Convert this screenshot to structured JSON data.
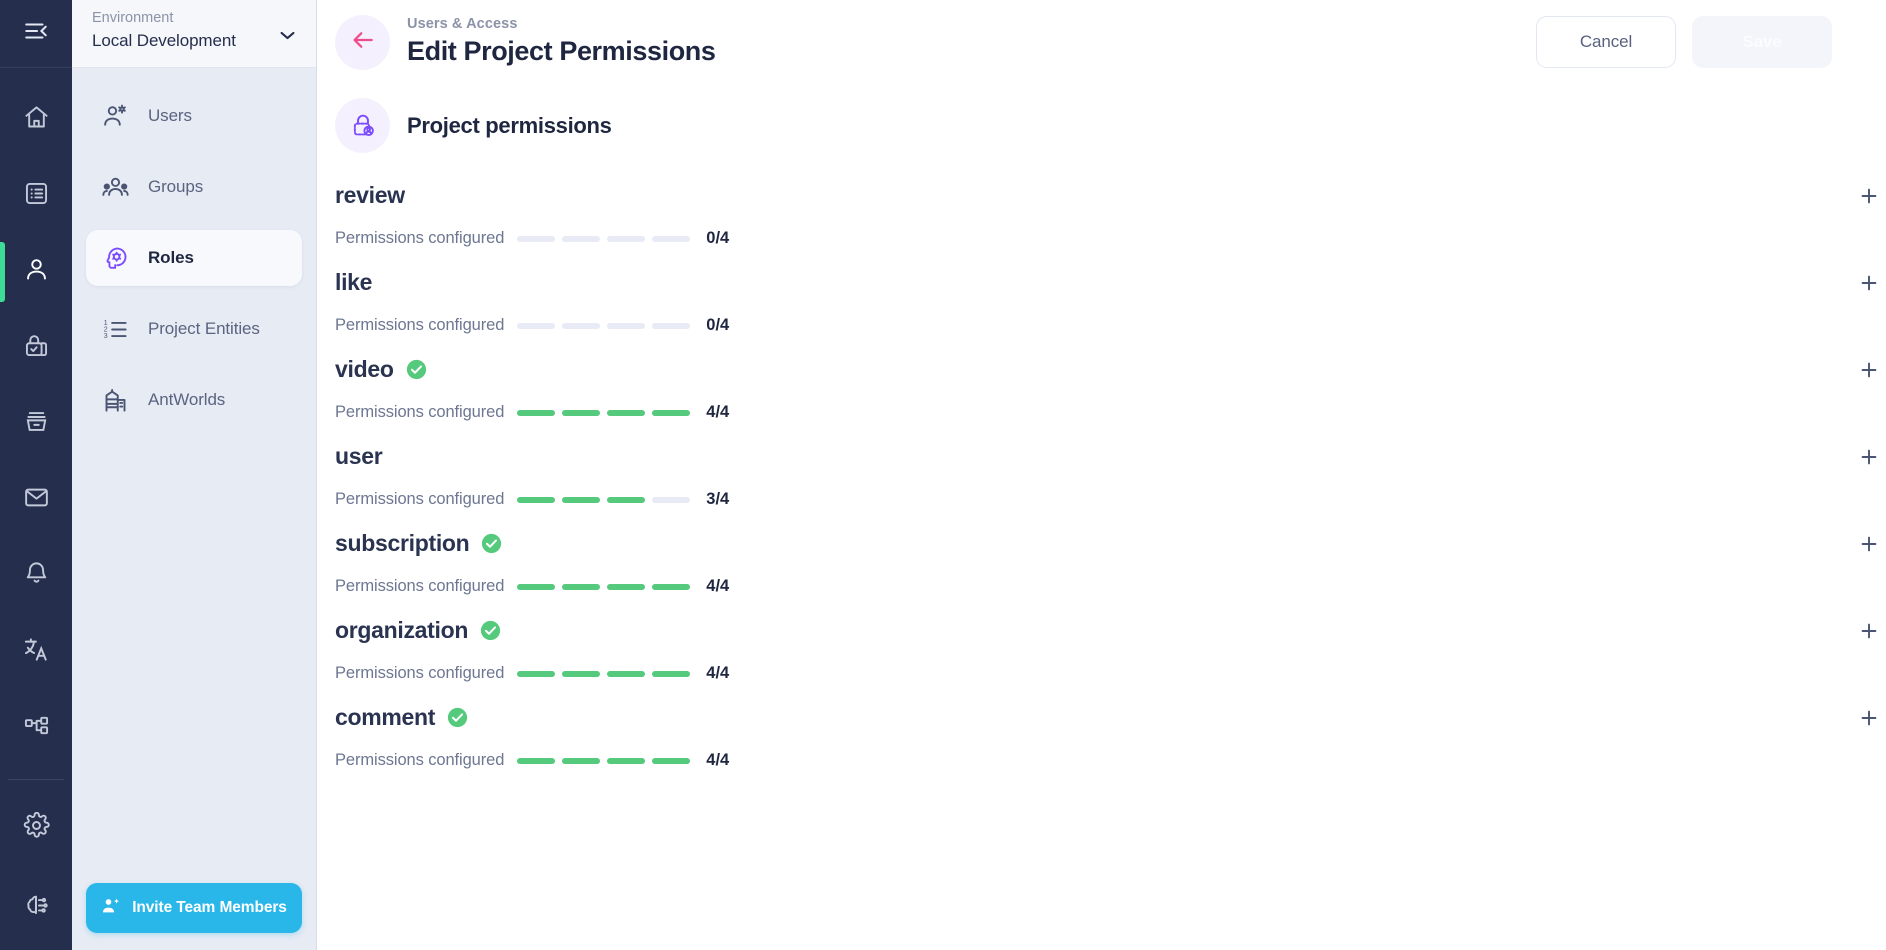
{
  "rail": {
    "collapse_icon": "collapse-sidebar-icon",
    "items": [
      {
        "name": "home",
        "icon": "home-icon",
        "active": false
      },
      {
        "name": "content",
        "icon": "list-box-icon",
        "active": false
      },
      {
        "name": "users-access",
        "icon": "person-icon",
        "active": true
      },
      {
        "name": "security",
        "icon": "lock-check-icon",
        "active": false
      },
      {
        "name": "storage",
        "icon": "archive-icon",
        "active": false
      },
      {
        "name": "mail",
        "icon": "envelope-icon",
        "active": false
      },
      {
        "name": "notifications",
        "icon": "bell-icon",
        "active": false
      },
      {
        "name": "localization",
        "icon": "translate-icon",
        "active": false
      },
      {
        "name": "workflows",
        "icon": "sitemap-icon",
        "active": false
      }
    ],
    "bottom_items": [
      {
        "name": "settings",
        "icon": "gear-icon",
        "active": false
      },
      {
        "name": "ai",
        "icon": "brain-circuit-icon",
        "active": false
      }
    ]
  },
  "sidebar": {
    "environment": {
      "label": "Environment",
      "value": "Local Development",
      "chevron_icon": "chevron-down-icon"
    },
    "items": [
      {
        "label": "Users",
        "icon": "user-settings-icon",
        "active": false
      },
      {
        "label": "Groups",
        "icon": "people-group-icon",
        "active": false
      },
      {
        "label": "Roles",
        "icon": "head-gear-icon",
        "active": true
      },
      {
        "label": "Project Entities",
        "icon": "numbered-list-icon",
        "active": false
      },
      {
        "label": "AntWorlds",
        "icon": "building-icon",
        "active": false
      }
    ],
    "invite_button": {
      "label": "Invite Team Members",
      "icon": "person-add-icon",
      "color": "#29b6e8"
    }
  },
  "header": {
    "back_icon": "arrow-left-icon",
    "breadcrumb": "Users & Access",
    "title": "Edit Project Permissions",
    "cancel_label": "Cancel",
    "save_label": "Save"
  },
  "section": {
    "icon": "lock-user-icon",
    "title": "Project permissions"
  },
  "permissions": {
    "meta_label": "Permissions configured",
    "total": 4,
    "add_icon": "plus-icon",
    "complete_icon": "check-circle-icon",
    "colors": {
      "filled": "#55c97c",
      "empty": "#e8ebf5",
      "accent": "#7c4dff",
      "back_arrow": "#ee4c8b"
    },
    "rows": [
      {
        "name": "review",
        "configured": 0,
        "ratio": "0/4",
        "complete": false
      },
      {
        "name": "like",
        "configured": 0,
        "ratio": "0/4",
        "complete": false
      },
      {
        "name": "video",
        "configured": 4,
        "ratio": "4/4",
        "complete": true
      },
      {
        "name": "user",
        "configured": 3,
        "ratio": "3/4",
        "complete": false
      },
      {
        "name": "subscription",
        "configured": 4,
        "ratio": "4/4",
        "complete": true
      },
      {
        "name": "organization",
        "configured": 4,
        "ratio": "4/4",
        "complete": true
      },
      {
        "name": "comment",
        "configured": 4,
        "ratio": "4/4",
        "complete": true
      }
    ]
  }
}
